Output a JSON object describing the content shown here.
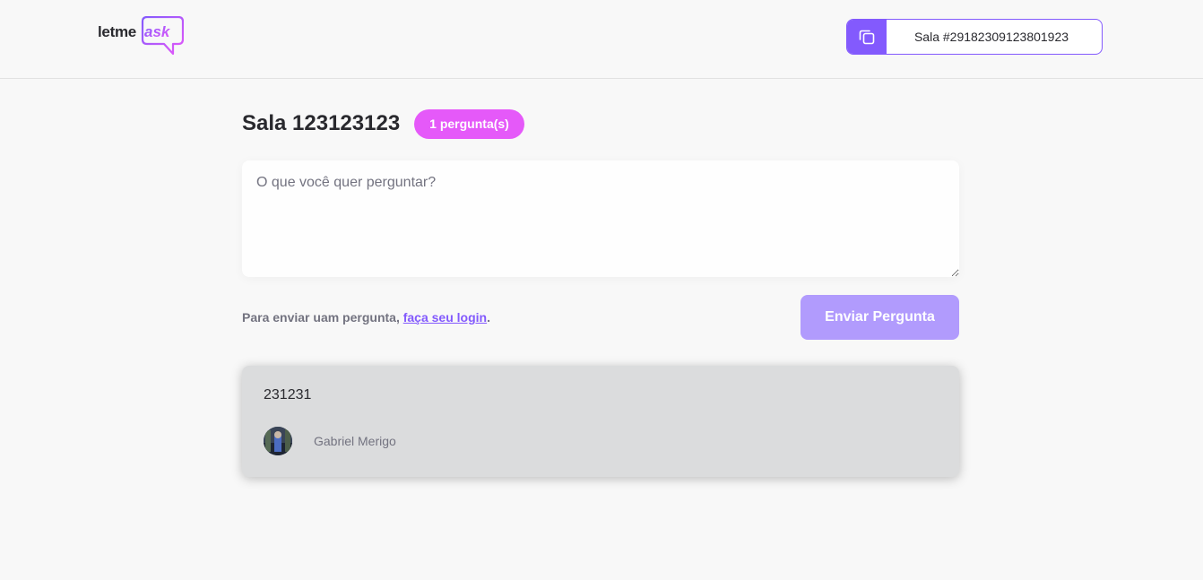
{
  "header": {
    "logo": {
      "part1": "letme",
      "part2": "ask"
    },
    "room_code": {
      "label": "Sala #29182309123801923",
      "icon": "copy-icon"
    }
  },
  "room": {
    "title": "Sala 123123123",
    "question_count_badge": "1 pergunta(s)"
  },
  "form": {
    "placeholder": "O que você quer perguntar?",
    "value": "",
    "login_prefix": "Para enviar uam pergunta, ",
    "login_link": "faça seu login",
    "login_suffix": ".",
    "submit_label": "Enviar Pergunta",
    "submit_disabled": true
  },
  "questions": [
    {
      "content": "231231",
      "author": {
        "name": "Gabriel Merigo",
        "avatar": "avatar-photo"
      }
    }
  ],
  "colors": {
    "brand_purple": "#835afd",
    "brand_pink": "#e559f9",
    "submit_disabled": "#b19bfd",
    "background": "#f8f8f8",
    "question_card": "#dbdcdd"
  }
}
